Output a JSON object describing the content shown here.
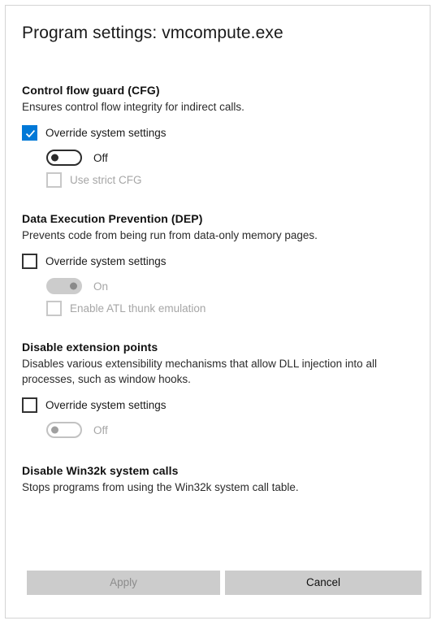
{
  "dialog": {
    "title": "Program settings: vmcompute.exe"
  },
  "sections": [
    {
      "title": "Control flow guard (CFG)",
      "description": "Ensures control flow integrity for indirect calls.",
      "override": {
        "label": "Override system settings",
        "checked": true,
        "enabled": true
      },
      "toggle": {
        "label": "Off",
        "state": "off",
        "enabled": true
      },
      "sub_option": {
        "label": "Use strict CFG",
        "checked": false,
        "enabled": false
      }
    },
    {
      "title": "Data Execution Prevention (DEP)",
      "description": "Prevents code from being run from data-only memory pages.",
      "override": {
        "label": "Override system settings",
        "checked": false,
        "enabled": true
      },
      "toggle": {
        "label": "On",
        "state": "on",
        "enabled": false
      },
      "sub_option": {
        "label": "Enable ATL thunk emulation",
        "checked": false,
        "enabled": false
      }
    },
    {
      "title": "Disable extension points",
      "description": "Disables various extensibility mechanisms that allow DLL injection into all processes, such as window hooks.",
      "override": {
        "label": "Override system settings",
        "checked": false,
        "enabled": true
      },
      "toggle": {
        "label": "Off",
        "state": "off",
        "enabled": false
      }
    },
    {
      "title": "Disable Win32k system calls",
      "description": "Stops programs from using the Win32k system call table."
    }
  ],
  "footer": {
    "apply_label": "Apply",
    "cancel_label": "Cancel"
  },
  "colors": {
    "accent": "#0078d7",
    "button_face": "#cccccc",
    "disabled_text": "#a6a6a6",
    "border": "#d4d4d4"
  }
}
